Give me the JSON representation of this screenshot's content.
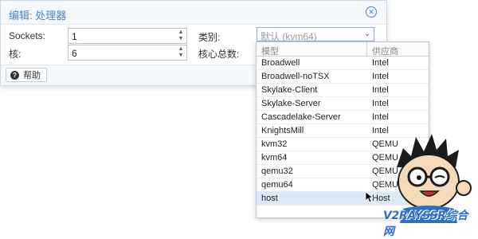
{
  "dialog": {
    "title": "编辑: 处理器",
    "sockets_label": "Sockets:",
    "sockets_value": "1",
    "cores_label": "核:",
    "cores_value": "6",
    "type_label": "类别:",
    "type_value": "默认 (kvm64)",
    "total_cores_label": "核心总数:",
    "help_label": "帮助"
  },
  "dropdown": {
    "col_model": "模型",
    "col_vendor": "供应商",
    "rows": [
      {
        "model": "Broadwell",
        "vendor": "Intel"
      },
      {
        "model": "Broadwell-noTSX",
        "vendor": "Intel"
      },
      {
        "model": "Skylake-Client",
        "vendor": "Intel"
      },
      {
        "model": "Skylake-Server",
        "vendor": "Intel"
      },
      {
        "model": "Cascadelake-Server",
        "vendor": "Intel"
      },
      {
        "model": "KnightsMill",
        "vendor": "Intel"
      },
      {
        "model": "kvm32",
        "vendor": "QEMU"
      },
      {
        "model": "kvm64",
        "vendor": "QEMU"
      },
      {
        "model": "qemu32",
        "vendor": "QEMU"
      },
      {
        "model": "qemu64",
        "vendor": "QEMU"
      },
      {
        "model": "host",
        "vendor": "Host"
      }
    ],
    "hover_index": 10
  },
  "watermark": {
    "text": "V2RAYSSR综合网"
  },
  "colors": {
    "title_blue": "#4a84c3",
    "hover_row": "#dbe8f6",
    "watermark_blue": "#2a6fcf"
  }
}
